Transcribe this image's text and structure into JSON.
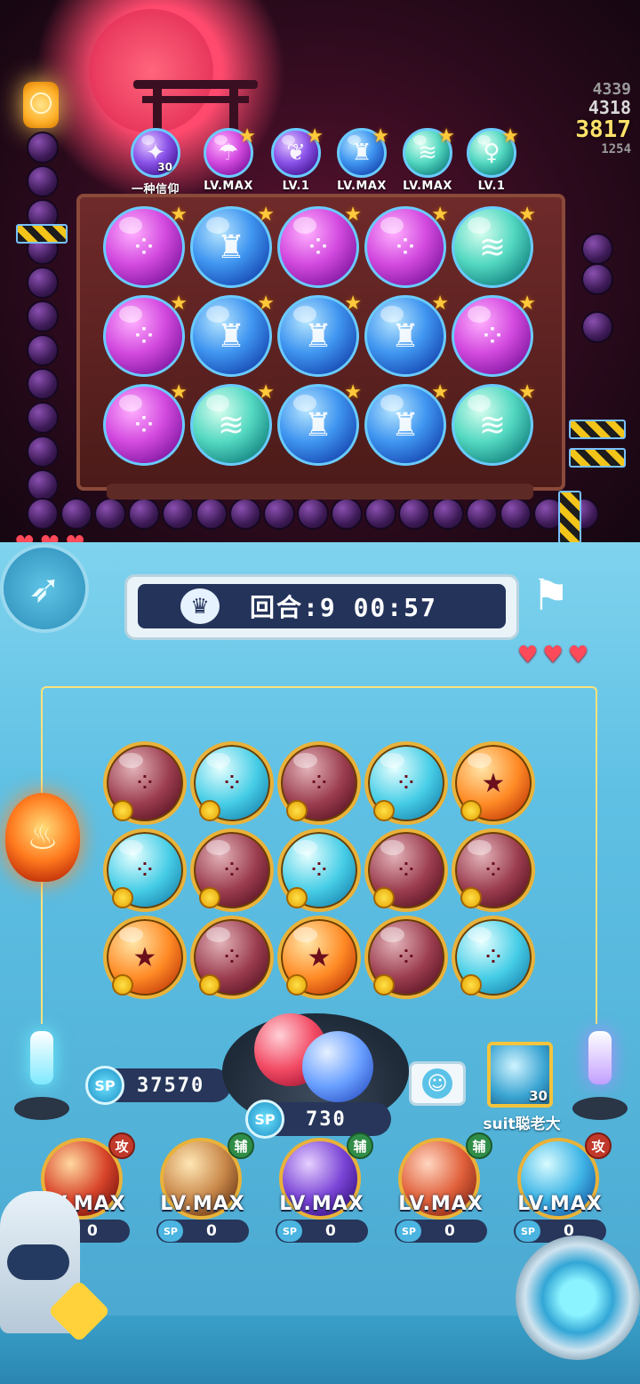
{
  "opponent": {
    "top_items": [
      {
        "label": "一种信仰",
        "level": "30",
        "color": "violet",
        "glyph": "✦"
      },
      {
        "label": "LV.MAX",
        "color": "pink",
        "glyph": "☂"
      },
      {
        "label": "LV.1",
        "color": "violet",
        "glyph": "❦"
      },
      {
        "label": "LV.MAX",
        "color": "blue",
        "glyph": "♜"
      },
      {
        "label": "LV.MAX",
        "color": "teal",
        "glyph": "≋"
      },
      {
        "label": "LV.1",
        "color": "teal",
        "glyph": "♀"
      }
    ],
    "scores": {
      "s1": "4339",
      "s2": "4318",
      "s3": "3817",
      "s4": "1254"
    },
    "board": [
      [
        "pink",
        "blue",
        "pink",
        "pink",
        "teal"
      ],
      [
        "pink",
        "blue",
        "blue",
        "blue",
        "pink"
      ],
      [
        "pink",
        "teal",
        "blue",
        "blue",
        "teal"
      ]
    ],
    "hearts": 3
  },
  "round": {
    "label": "回合:9  00:57"
  },
  "player": {
    "hearts": 3,
    "board": [
      [
        "red",
        "cyan",
        "red",
        "cyan",
        "orange"
      ],
      [
        "cyan",
        "red",
        "cyan",
        "red",
        "red"
      ],
      [
        "orange",
        "red",
        "orange",
        "red",
        "cyan"
      ]
    ],
    "sp_total": {
      "icon": "SP",
      "value": "37570"
    },
    "sp_current": {
      "icon": "SP",
      "value": "730"
    },
    "avatar": {
      "level": "30",
      "name": "suit聪老大"
    },
    "slots": [
      {
        "level": "LV.MAX",
        "sp": "0",
        "tag": "攻",
        "tag_type": "atk",
        "sp_icon": "SP"
      },
      {
        "level": "LV.MAX",
        "sp": "0",
        "tag": "辅",
        "tag_type": "sup",
        "sp_icon": "SP"
      },
      {
        "level": "LV.MAX",
        "sp": "0",
        "tag": "辅",
        "tag_type": "sup",
        "sp_icon": "SP"
      },
      {
        "level": "LV.MAX",
        "sp": "0",
        "tag": "辅",
        "tag_type": "sup",
        "sp_icon": "SP"
      },
      {
        "level": "LV.MAX",
        "sp": "0",
        "tag": "攻",
        "tag_type": "atk",
        "sp_icon": "SP"
      }
    ]
  }
}
